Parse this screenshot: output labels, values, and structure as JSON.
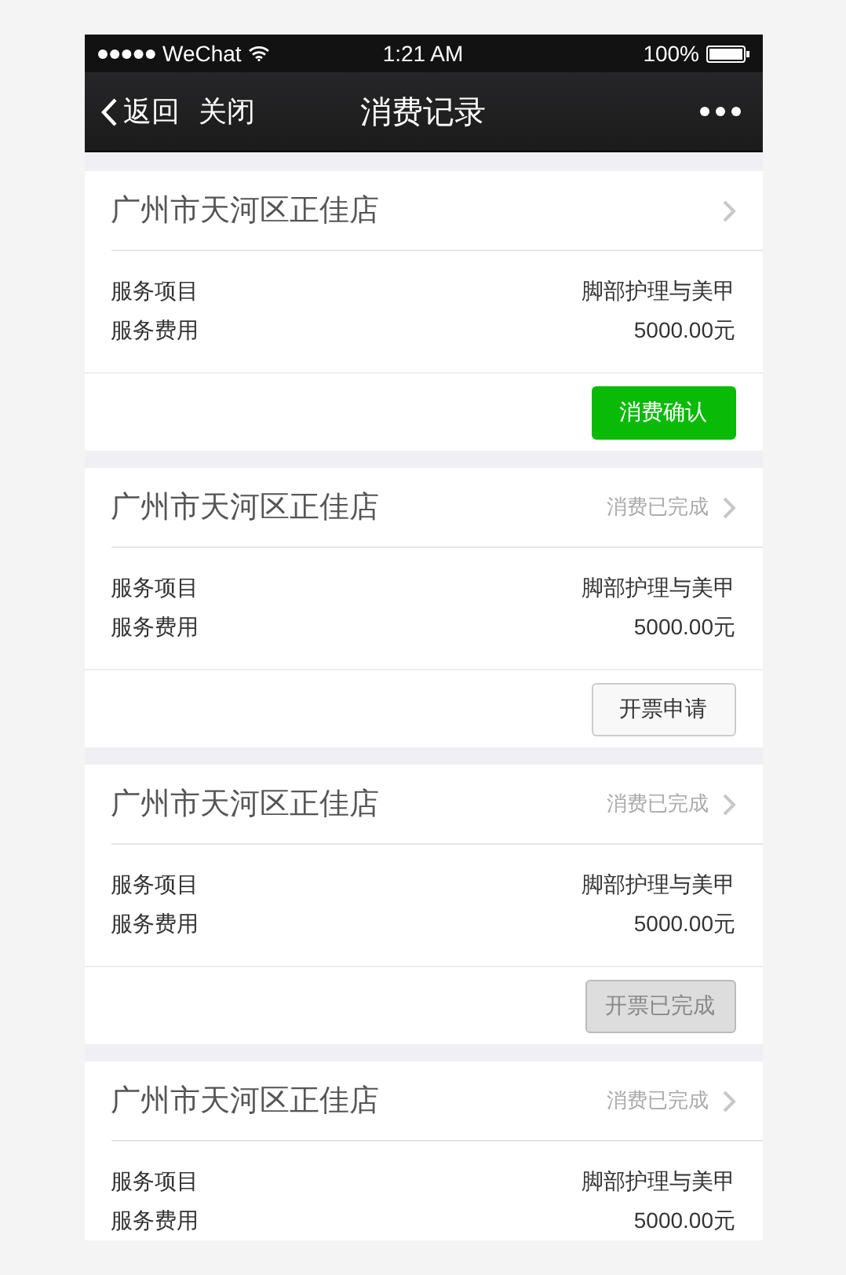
{
  "status_bar": {
    "carrier": "WeChat",
    "time": "1:21 AM",
    "battery": "100%"
  },
  "nav": {
    "back": "返回",
    "close": "关闭",
    "title": "消费记录"
  },
  "records": [
    {
      "store": "广州市天河区正佳店",
      "rows": [
        {
          "label": "服务项目",
          "value": "脚部护理与美甲"
        },
        {
          "label": "服务费用",
          "value": "5000.00元"
        }
      ],
      "button": {
        "label": "消费确认",
        "kind": "primary"
      }
    },
    {
      "store": "广州市天河区正佳店",
      "status": "消费已完成",
      "rows": [
        {
          "label": "服务项目",
          "value": "脚部护理与美甲"
        },
        {
          "label": "服务费用",
          "value": "5000.00元"
        }
      ],
      "button": {
        "label": "开票申请",
        "kind": "default"
      }
    },
    {
      "store": "广州市天河区正佳店",
      "status": "消费已完成",
      "rows": [
        {
          "label": "服务项目",
          "value": "脚部护理与美甲"
        },
        {
          "label": "服务费用",
          "value": "5000.00元"
        }
      ],
      "button": {
        "label": "开票已完成",
        "kind": "disabled"
      }
    },
    {
      "store": "广州市天河区正佳店",
      "status": "消费已完成",
      "rows": [
        {
          "label": "服务项目",
          "value": "脚部护理与美甲"
        },
        {
          "label": "服务费用",
          "value": "5000.00元"
        }
      ]
    }
  ]
}
